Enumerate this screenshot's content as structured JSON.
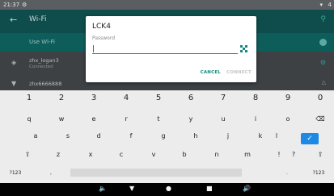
{
  "status_bar": {
    "time": "21:37",
    "settings_icon": "gear-icon",
    "signal_icon": "wifi-signal-icon",
    "battery": "4"
  },
  "app_bar": {
    "title": "Wi-Fi",
    "back_icon": "back-arrow-icon",
    "search_icon": "search-icon"
  },
  "use_wifi": {
    "label": "Use Wi-Fi"
  },
  "networks": [
    {
      "name": "zhx_logan3",
      "status": "Connected"
    },
    {
      "name": "zhx6666888",
      "status": ""
    }
  ],
  "dialog": {
    "title": "LCK4",
    "hint": "Password",
    "value": "",
    "cancel_label": "CANCEL",
    "connect_label": "CONNECT"
  },
  "keyboard": {
    "numbers": [
      "1",
      "2",
      "3",
      "4",
      "5",
      "6",
      "7",
      "8",
      "9",
      "0"
    ],
    "row_q": [
      "q",
      "w",
      "e",
      "r",
      "t",
      "y",
      "u",
      "i",
      "o",
      "p"
    ],
    "row_a": [
      "a",
      "s",
      "d",
      "f",
      "g",
      "h",
      "j",
      "k",
      "l"
    ],
    "row_z": [
      "z",
      "x",
      "c",
      "v",
      "b",
      "n",
      "m",
      "!",
      "?"
    ],
    "symbols_label": "?123",
    "comma": ",",
    "period": ".",
    "symbols_right_label": "?123",
    "backspace_icon": "backspace-icon",
    "enter_icon": "enter-check-icon",
    "shift_icon": "shift-icon",
    "shift_right_icon": "shift-icon"
  },
  "nav_bar": {
    "volume_down_icon": "volume-down-icon",
    "back_icon": "back-triangle-icon",
    "home_icon": "home-circle-icon",
    "recents_icon": "recents-square-icon",
    "volume_up_icon": "volume-up-icon"
  }
}
